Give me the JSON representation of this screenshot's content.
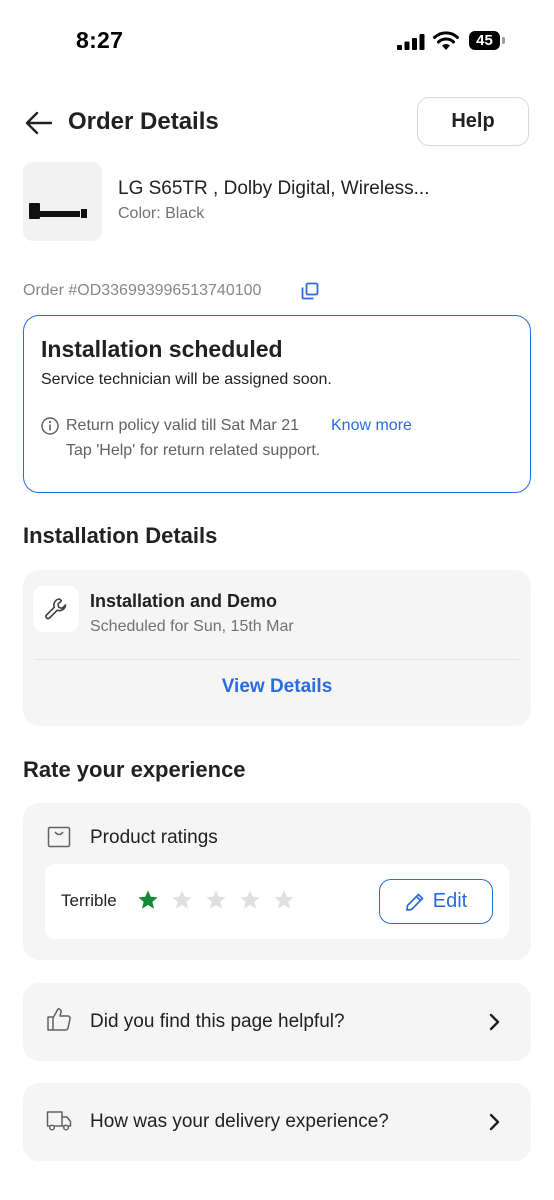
{
  "status_bar": {
    "time": "8:27",
    "battery": "45"
  },
  "header": {
    "title": "Order Details",
    "help_label": "Help"
  },
  "product": {
    "name": "LG S65TR , Dolby Digital, Wireless...",
    "color": "Color: Black"
  },
  "order": {
    "id": "Order #OD336993996513740100"
  },
  "status": {
    "title": "Installation scheduled",
    "subtitle": "Service technician will be assigned soon.",
    "return_policy": "Return policy valid till Sat Mar 21",
    "know_more": "Know more",
    "tap_help": "Tap 'Help' for return related support."
  },
  "installation": {
    "section_title": "Installation Details",
    "title": "Installation and Demo",
    "scheduled": "Scheduled for Sun, 15th Mar",
    "view_details": "View Details"
  },
  "rating": {
    "section_title": "Rate your experience",
    "product_ratings": "Product ratings",
    "rating_label": "Terrible",
    "stars_filled": 1,
    "stars_total": 5,
    "edit_label": "Edit"
  },
  "feedback": {
    "helpful": "Did you find this page helpful?",
    "delivery": "How was your delivery experience?"
  },
  "colors": {
    "accent_blue": "#2a6be0",
    "star_green": "#138a36",
    "star_grey": "#e0e0e0"
  }
}
